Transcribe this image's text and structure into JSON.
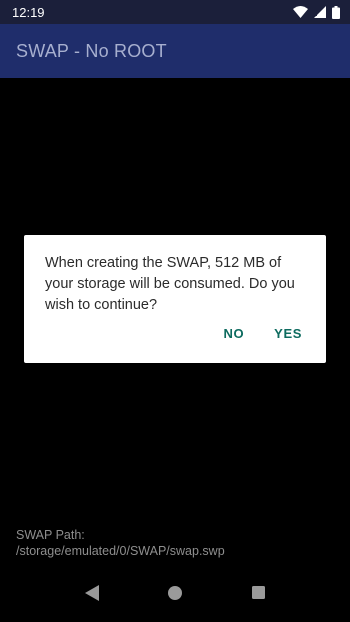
{
  "status_bar": {
    "time": "12:19",
    "icons": [
      "wifi-icon",
      "cell-signal-icon",
      "battery-icon"
    ]
  },
  "app_bar": {
    "title": "SWAP - No ROOT"
  },
  "dialog": {
    "message": "When creating the SWAP, 512 MB of your storage will be consumed. Do you wish to continue?",
    "no_label": "NO",
    "yes_label": "YES"
  },
  "footer": {
    "swap_path_label": "SWAP Path:",
    "swap_path_value": "/storage/emulated/0/SWAP/swap.swp"
  },
  "nav_bar": {
    "icons": [
      "back-icon",
      "home-icon",
      "recents-icon"
    ]
  },
  "colors": {
    "status_bar_bg": "#1b1f3a",
    "app_bar_bg": "#1f2d6b",
    "accent": "#0d6b5f",
    "background": "#000000"
  }
}
